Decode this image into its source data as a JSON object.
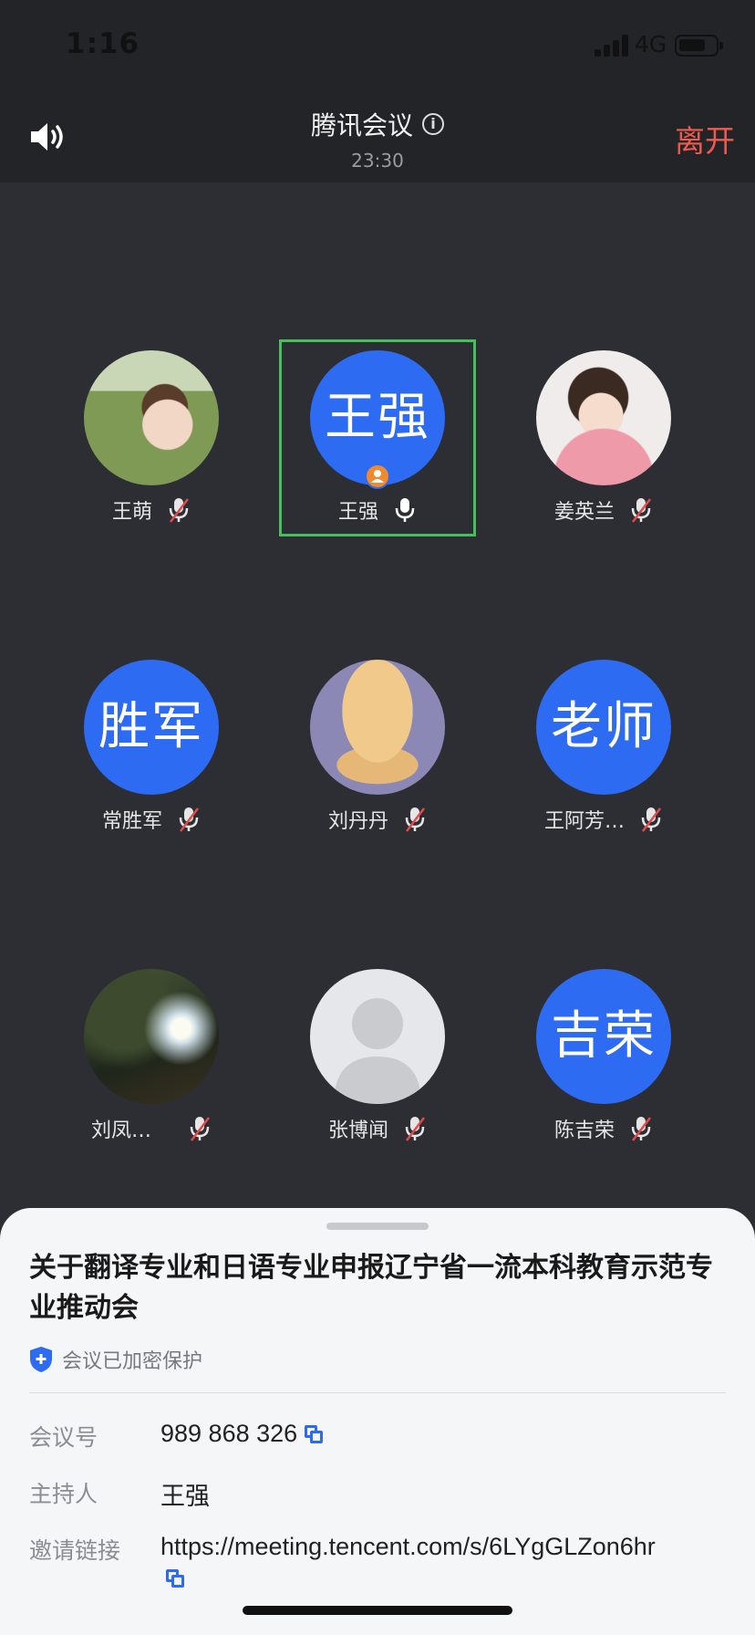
{
  "status_bar": {
    "time": "1:16",
    "network": "4G",
    "battery_level": 0.6
  },
  "header": {
    "title": "腾讯会议",
    "duration": "23:30",
    "leave_label": "离开"
  },
  "participants": [
    {
      "name": "王萌",
      "type": "photo",
      "muted": true
    },
    {
      "name": "王强",
      "type": "text",
      "avatar_text": "王强",
      "muted": false,
      "host": true,
      "speaking": true
    },
    {
      "name": "姜英兰",
      "type": "photo",
      "muted": true
    },
    {
      "name": "常胜军",
      "type": "text",
      "avatar_text": "胜军",
      "muted": true
    },
    {
      "name": "刘丹丹",
      "type": "photo",
      "muted": true
    },
    {
      "name": "王阿芳…",
      "type": "text",
      "avatar_text": "老师",
      "muted": true
    },
    {
      "name": "刘凤…",
      "type": "photo",
      "muted": true
    },
    {
      "name": "张博闻",
      "type": "default",
      "muted": true
    },
    {
      "name": "陈吉荣",
      "type": "text",
      "avatar_text": "吉荣",
      "muted": true
    }
  ],
  "meeting": {
    "title": "关于翻译专业和日语专业申报辽宁省一流本科教育示范专业推动会",
    "secure_label": "会议已加密保护",
    "id_label": "会议号",
    "id_value": "989 868 326",
    "host_label": "主持人",
    "host_value": "王强",
    "link_label": "邀请链接",
    "link_value": "https://meeting.tencent.com/s/6LYgGLZon6hr"
  },
  "colors": {
    "accent": "#2d6bf3",
    "leave": "#ef5a4f",
    "speaking_border": "#45c05b",
    "host_badge": "#f08a2c"
  }
}
